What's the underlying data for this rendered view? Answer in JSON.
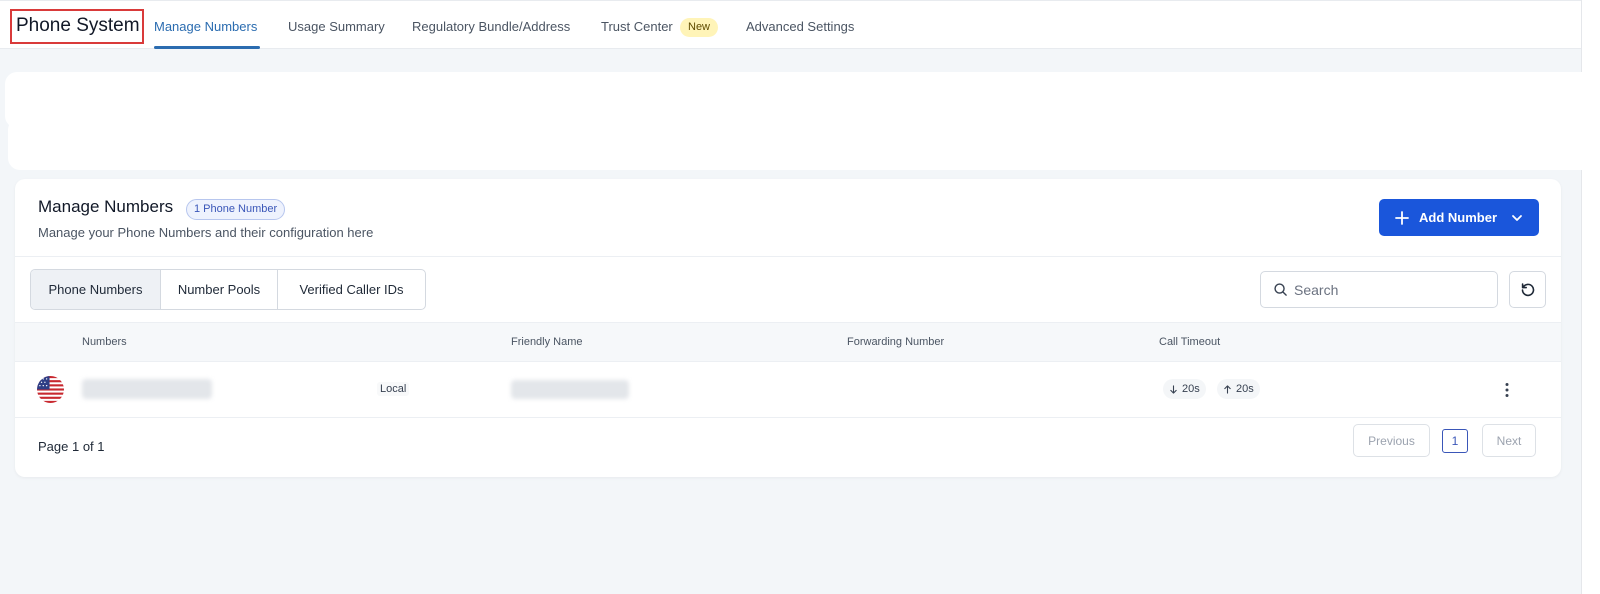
{
  "app": {
    "title": "Phone System"
  },
  "nav": {
    "tabs": [
      {
        "label": "Manage Numbers",
        "active": true
      },
      {
        "label": "Usage Summary"
      },
      {
        "label": "Regulatory Bundle/Address"
      },
      {
        "label": "Trust Center",
        "badge": "New"
      },
      {
        "label": "Advanced Settings"
      }
    ]
  },
  "manage": {
    "title": "Manage Numbers",
    "count_badge": "1 Phone Number",
    "subtitle": "Manage your Phone Numbers and their configuration here",
    "add_button": "Add Number"
  },
  "subtabs": [
    {
      "label": "Phone Numbers",
      "active": true
    },
    {
      "label": "Number Pools"
    },
    {
      "label": "Verified Caller IDs"
    }
  ],
  "search": {
    "placeholder": "Search",
    "value": ""
  },
  "table": {
    "columns": [
      "Numbers",
      "Friendly Name",
      "Forwarding Number",
      "Call Timeout"
    ],
    "rows": [
      {
        "flag": "us-flag-icon",
        "number": "",
        "type": "Local",
        "friendly_name": "",
        "forwarding_number": "",
        "timeout_in": "20s",
        "timeout_out": "20s"
      }
    ]
  },
  "pagination": {
    "info": "Page 1 of 1",
    "previous": "Previous",
    "current": "1",
    "next": "Next"
  },
  "colors": {
    "accent": "#2b6cb0",
    "primary_button": "#1a56db",
    "badge_new_bg": "#fff4b8",
    "title_outline": "#d93a3a"
  }
}
